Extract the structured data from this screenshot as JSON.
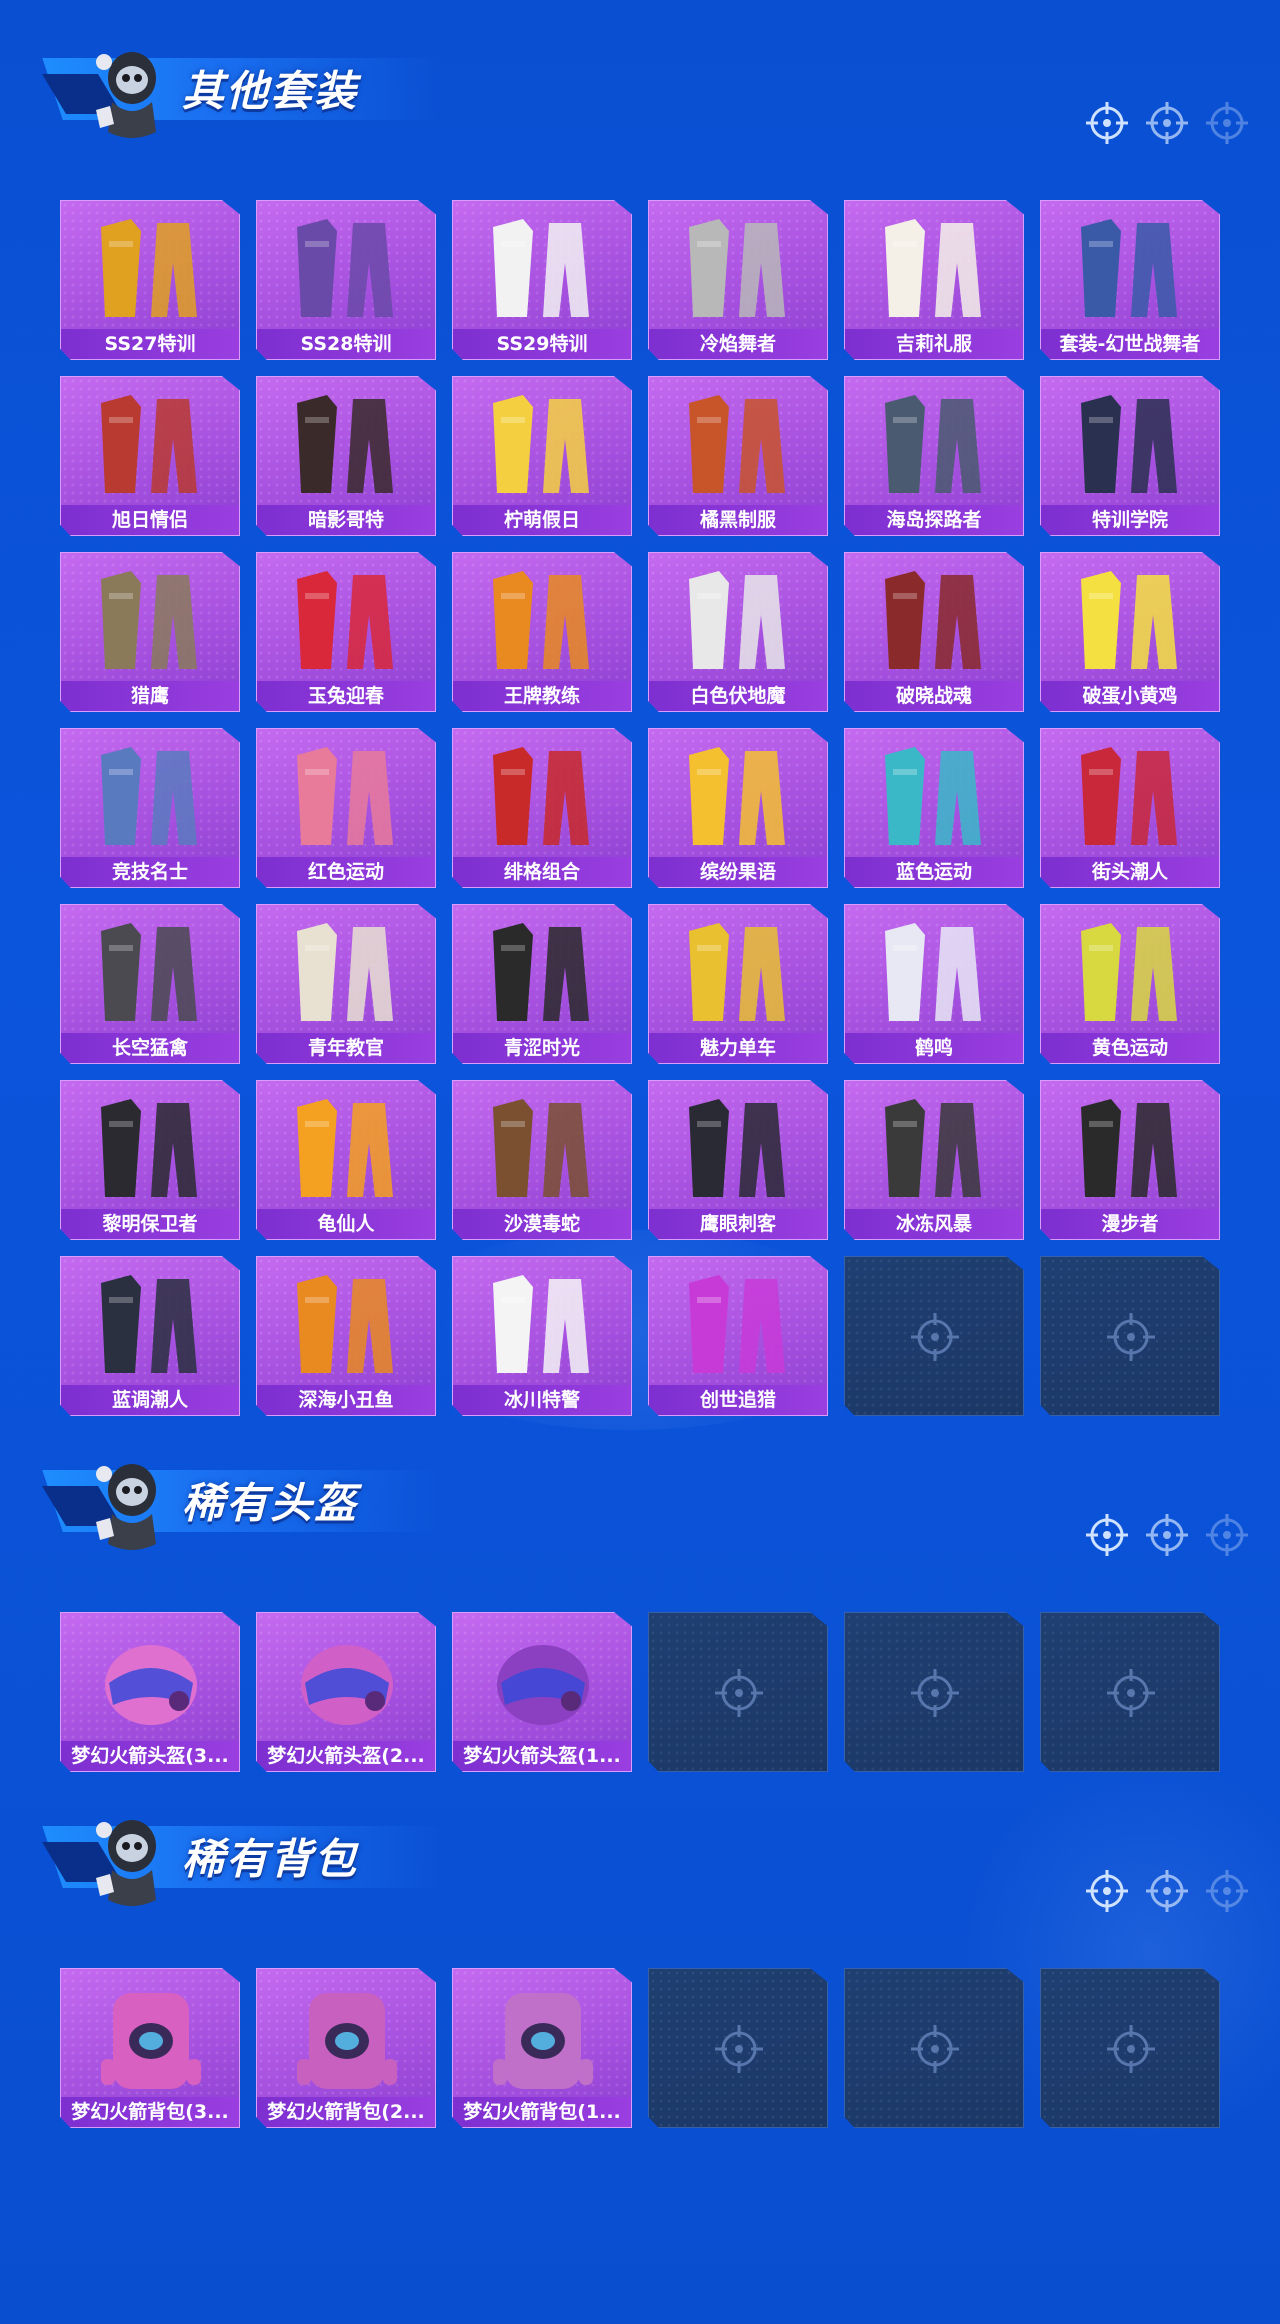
{
  "colors": {
    "page_bg": "#0b55dc",
    "card_bg": "#a751e0",
    "label_bg": "#7d2fd0",
    "empty_bg": "#1f3f72"
  },
  "sections": [
    {
      "title": "其他套装",
      "items": [
        {
          "label": "SS27特训",
          "icon": "outfit-icon",
          "tint": "#e0a020"
        },
        {
          "label": "SS28特训",
          "icon": "outfit-icon",
          "tint": "#6a4aa8"
        },
        {
          "label": "SS29特训",
          "icon": "outfit-icon",
          "tint": "#f2f2f2"
        },
        {
          "label": "冷焰舞者",
          "icon": "outfit-icon",
          "tint": "#b8b8b8"
        },
        {
          "label": "吉莉礼服",
          "icon": "outfit-icon",
          "tint": "#f4f0e8"
        },
        {
          "label": "套装-幻世战舞者",
          "icon": "outfit-icon",
          "tint": "#3a5aa8"
        },
        {
          "label": "旭日情侣",
          "icon": "outfit-icon",
          "tint": "#b83a30"
        },
        {
          "label": "暗影哥特",
          "icon": "outfit-icon",
          "tint": "#3a2a2a"
        },
        {
          "label": "柠萌假日",
          "icon": "outfit-icon",
          "tint": "#f4d040"
        },
        {
          "label": "橘黑制服",
          "icon": "outfit-icon",
          "tint": "#c8542a"
        },
        {
          "label": "海岛探路者",
          "icon": "outfit-icon",
          "tint": "#4a5a70"
        },
        {
          "label": "特训学院",
          "icon": "outfit-icon",
          "tint": "#2a3050"
        },
        {
          "label": "猎鹰",
          "icon": "outfit-icon",
          "tint": "#8a7a5a"
        },
        {
          "label": "玉兔迎春",
          "icon": "outfit-icon",
          "tint": "#d8283a"
        },
        {
          "label": "王牌教练",
          "icon": "outfit-icon",
          "tint": "#e88a20"
        },
        {
          "label": "白色伏地魔",
          "icon": "outfit-icon",
          "tint": "#e8e8e8"
        },
        {
          "label": "破晓战魂",
          "icon": "outfit-icon",
          "tint": "#8a2a2a"
        },
        {
          "label": "破蛋小黄鸡",
          "icon": "outfit-icon",
          "tint": "#f4e040"
        },
        {
          "label": "竞技名士",
          "icon": "outfit-icon",
          "tint": "#5a7ac0"
        },
        {
          "label": "红色运动",
          "icon": "outfit-icon",
          "tint": "#e87a9a"
        },
        {
          "label": "绯格组合",
          "icon": "outfit-icon",
          "tint": "#c82a2a"
        },
        {
          "label": "缤纷果语",
          "icon": "outfit-icon",
          "tint": "#f4c030"
        },
        {
          "label": "蓝色运动",
          "icon": "outfit-icon",
          "tint": "#3ab8c8"
        },
        {
          "label": "街头潮人",
          "icon": "outfit-icon",
          "tint": "#c8283a"
        },
        {
          "label": "长空猛禽",
          "icon": "outfit-icon",
          "tint": "#4a4a50"
        },
        {
          "label": "青年教官",
          "icon": "outfit-icon",
          "tint": "#e8e0d0"
        },
        {
          "label": "青涩时光",
          "icon": "outfit-icon",
          "tint": "#2a2a2a"
        },
        {
          "label": "魅力单车",
          "icon": "outfit-icon",
          "tint": "#e8c030"
        },
        {
          "label": "鹤鸣",
          "icon": "outfit-icon",
          "tint": "#e8e8f4"
        },
        {
          "label": "黄色运动",
          "icon": "outfit-icon",
          "tint": "#d8d840"
        },
        {
          "label": "黎明保卫者",
          "icon": "outfit-icon",
          "tint": "#2a2a30"
        },
        {
          "label": "龟仙人",
          "icon": "outfit-icon",
          "tint": "#f4a020"
        },
        {
          "label": "沙漠毒蛇",
          "icon": "outfit-icon",
          "tint": "#7a5030"
        },
        {
          "label": "鹰眼刺客",
          "icon": "outfit-icon",
          "tint": "#2a2a34"
        },
        {
          "label": "冰冻风暴",
          "icon": "outfit-icon",
          "tint": "#3a3a3a"
        },
        {
          "label": "漫步者",
          "icon": "outfit-icon",
          "tint": "#2a2a2a"
        },
        {
          "label": "蓝调潮人",
          "icon": "outfit-icon",
          "tint": "#2a3040"
        },
        {
          "label": "深海小丑鱼",
          "icon": "outfit-icon",
          "tint": "#e88a20"
        },
        {
          "label": "冰川特警",
          "icon": "outfit-icon",
          "tint": "#f4f4f4"
        },
        {
          "label": "创世追猎",
          "icon": "outfit-icon",
          "tint": "#c83ad8"
        }
      ],
      "empty_slots": 2
    },
    {
      "title": "稀有头盔",
      "items": [
        {
          "label": "梦幻火箭头盔(3...",
          "icon": "helmet-icon",
          "tint": "#e070d0"
        },
        {
          "label": "梦幻火箭头盔(2...",
          "icon": "helmet-icon",
          "tint": "#d060c8"
        },
        {
          "label": "梦幻火箭头盔(1...",
          "icon": "helmet-icon",
          "tint": "#8a40c0"
        }
      ],
      "empty_slots": 3
    },
    {
      "title": "稀有背包",
      "items": [
        {
          "label": "梦幻火箭背包(3...",
          "icon": "backpack-icon",
          "tint": "#d860c0"
        },
        {
          "label": "梦幻火箭背包(2...",
          "icon": "backpack-icon",
          "tint": "#c860c0"
        },
        {
          "label": "梦幻火箭背包(1...",
          "icon": "backpack-icon",
          "tint": "#c070c8"
        }
      ],
      "empty_slots": 3
    }
  ]
}
